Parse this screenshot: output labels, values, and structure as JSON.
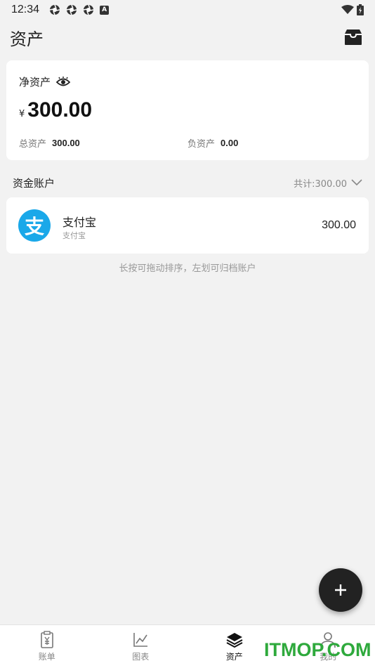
{
  "status_bar": {
    "time": "12:34",
    "badge_letter": "A"
  },
  "app_bar": {
    "title": "资产"
  },
  "net_assets": {
    "label": "净资产",
    "currency": "¥",
    "value": "300.00",
    "total_label": "总资产",
    "total_value": "300.00",
    "debt_label": "负资产",
    "debt_value": "0.00"
  },
  "accounts_section": {
    "title": "资金账户",
    "total_text": "共计:300.00"
  },
  "accounts": [
    {
      "logo_char": "支",
      "name": "支付宝",
      "subtitle": "支付宝",
      "balance": "300.00"
    }
  ],
  "hint": "长按可拖动排序，左划可归档账户",
  "bottom_nav": [
    {
      "label": "账单",
      "icon": "bill-icon"
    },
    {
      "label": "图表",
      "icon": "chart-icon"
    },
    {
      "label": "资产",
      "icon": "layers-icon",
      "active": true
    },
    {
      "label": "我的",
      "icon": "person-icon"
    }
  ],
  "watermark": "ITMOP.COM",
  "colors": {
    "alipay": "#1aa8e9",
    "fab": "#222222",
    "watermark": "#2ea93c"
  }
}
